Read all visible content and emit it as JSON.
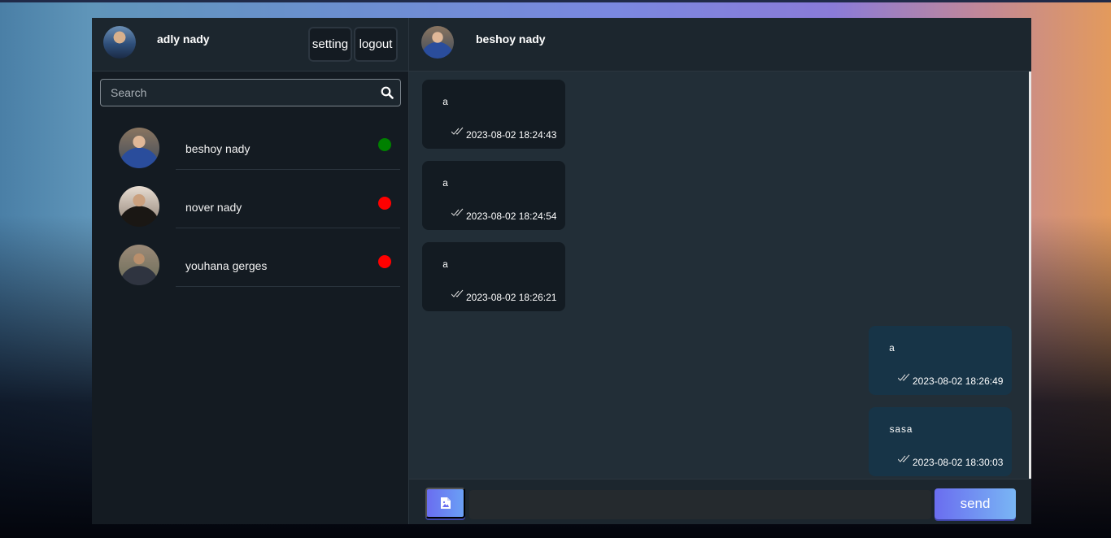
{
  "current_user": {
    "name": "adly nady"
  },
  "header_buttons": {
    "setting": "setting",
    "logout": "logout"
  },
  "search": {
    "placeholder": "Search"
  },
  "contacts": [
    {
      "name": "beshoy nady",
      "status": "online",
      "status_color": "#008000"
    },
    {
      "name": "nover nady",
      "status": "offline",
      "status_color": "#ff0000"
    },
    {
      "name": "youhana gerges",
      "status": "offline",
      "status_color": "#ff0000"
    }
  ],
  "chat": {
    "peer_name": "beshoy nady",
    "messages": [
      {
        "direction": "incoming",
        "text": "a",
        "time": "2023-08-02 18:24:43",
        "read_icon": "double-check-icon"
      },
      {
        "direction": "incoming",
        "text": "a",
        "time": "2023-08-02 18:24:54",
        "read_icon": "double-check-icon"
      },
      {
        "direction": "incoming",
        "text": "a",
        "time": "2023-08-02 18:26:21",
        "read_icon": "double-check-icon"
      },
      {
        "direction": "outgoing",
        "text": "a",
        "time": "2023-08-02 18:26:49",
        "read_icon": "double-check-icon"
      },
      {
        "direction": "outgoing",
        "text": "sasa",
        "time": "2023-08-02 18:30:03",
        "read_icon": "double-check-icon"
      }
    ]
  },
  "composer": {
    "input_value": "",
    "send_label": "send",
    "attach_icon": "image-file-icon"
  }
}
